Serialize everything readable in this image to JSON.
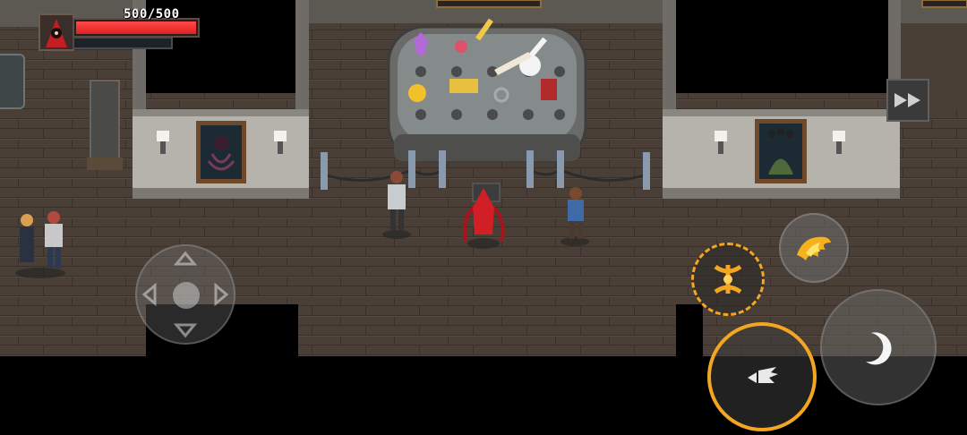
{
  "hud": {
    "hp_text": "500/500",
    "hp_current": 500,
    "hp_max": 500,
    "hp_fill_fraction": 1.0,
    "hp_color": "#e02020",
    "portrait_icon": "red-hooded-hero-portrait-icon"
  },
  "controls": {
    "fast_forward_icon": "fast-forward-icon",
    "joystick_icon": "virtual-joystick-icon",
    "skills": [
      {
        "name": "skill-fire-burst",
        "icon": "fire-burst-icon"
      },
      {
        "name": "skill-golden-rune",
        "icon": "golden-rune-icon"
      },
      {
        "name": "skill-primary-attack",
        "icon": "claw-attack-icon"
      },
      {
        "name": "skill-crescent-dash",
        "icon": "crescent-moon-icon"
      }
    ],
    "accent_color": "#f2a622"
  },
  "scene": {
    "location": "museum-gallery",
    "display_case_items": [
      "purple-crystal-icon",
      "pink-bow-icon",
      "golden-key-icon",
      "feathered-wand-icon",
      "skull-bomb-icon",
      "gold-bars-icon",
      "vip-ticket-icon",
      "chained-hook-icon",
      "red-book-icon",
      "moth-wings-icon"
    ],
    "paintings": [
      "tentacle-figure-painting",
      "green-eyed-monster-painting"
    ]
  }
}
